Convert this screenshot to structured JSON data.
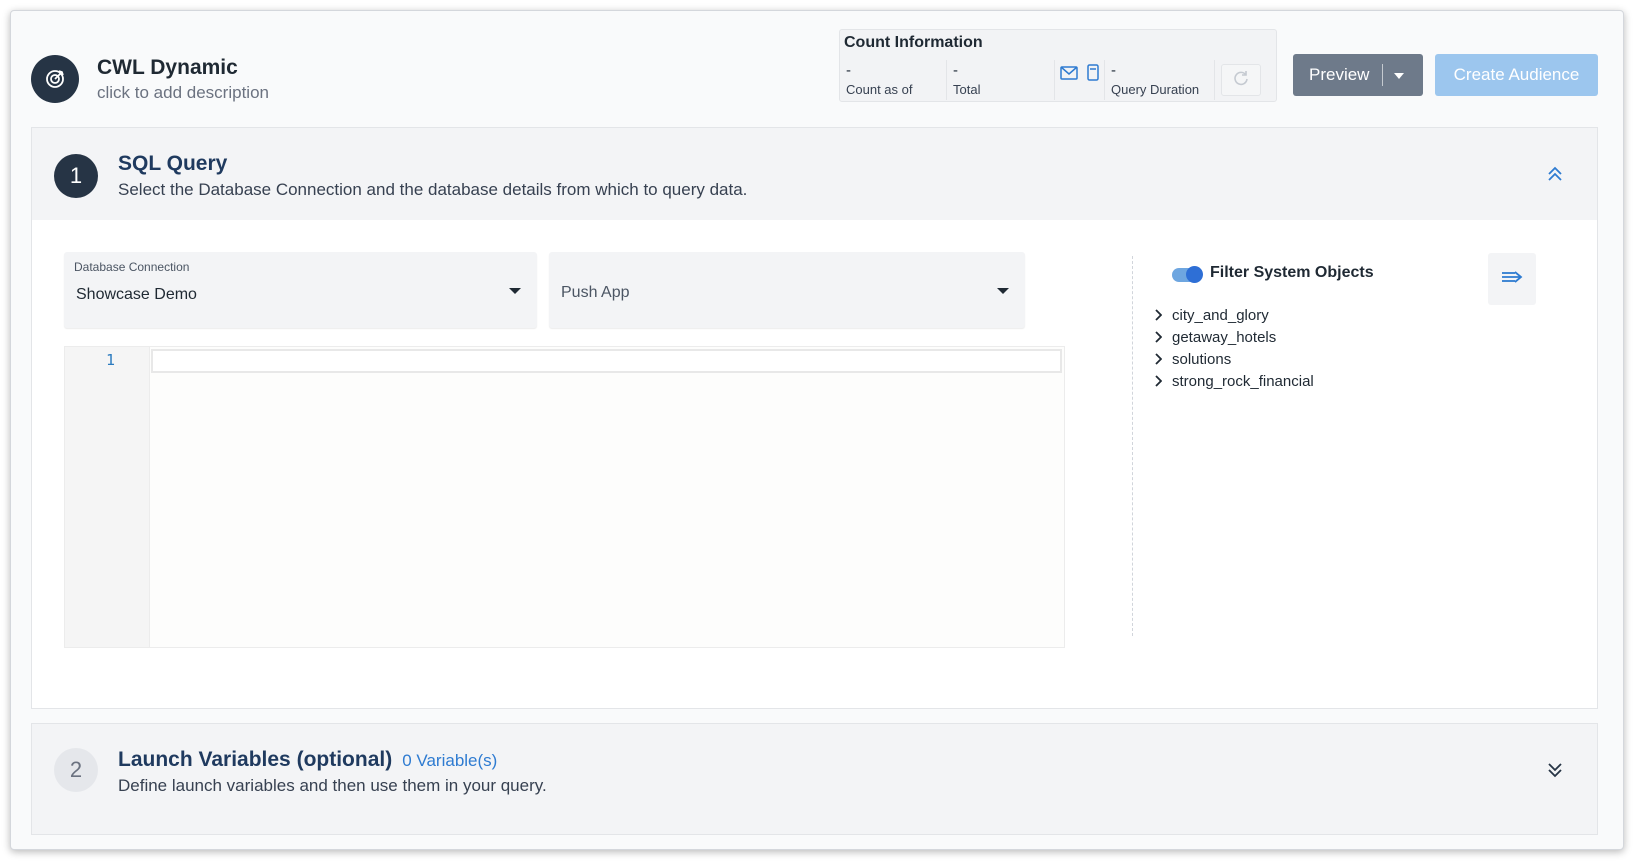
{
  "header": {
    "title": "CWL Dynamic",
    "description": "click to add description",
    "logo_icon": "target-icon"
  },
  "count_info": {
    "title": "Count Information",
    "count_as_of": {
      "value": "-",
      "label": "Count as of"
    },
    "total": {
      "value": "-",
      "label": "Total"
    },
    "query_duration": {
      "value": "-",
      "label": "Query Duration"
    },
    "channel_icons": [
      "email-icon",
      "mobile-icon"
    ],
    "refresh_icon": "refresh-icon"
  },
  "actions": {
    "preview_label": "Preview",
    "create_label": "Create Audience"
  },
  "section1": {
    "step": "1",
    "title": "SQL Query",
    "subtitle": "Select the Database Connection and the database details from which to query data.",
    "db_connection": {
      "label": "Database Connection",
      "value": "Showcase Demo"
    },
    "app_select": {
      "placeholder": "Push App"
    },
    "editor": {
      "line_number": "1",
      "content": ""
    },
    "filter_label": "Filter System Objects",
    "filter_enabled": true,
    "tree": [
      "city_and_glory",
      "getaway_hotels",
      "solutions",
      "strong_rock_financial"
    ]
  },
  "section2": {
    "step": "2",
    "title": "Launch Variables (optional)",
    "variable_count": "0 Variable(s)",
    "subtitle": "Define launch variables and then use them in your query."
  },
  "colors": {
    "accent": "#2e7bd1",
    "dark": "#263445",
    "create_button": "#9cc6ee",
    "preview_button": "#6e7a8a"
  }
}
